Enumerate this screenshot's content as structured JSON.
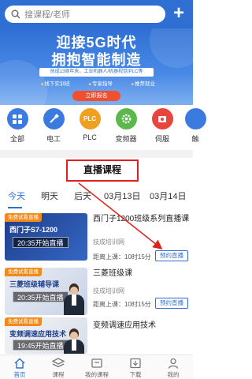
{
  "search": {
    "placeholder": "搜课程/老师"
  },
  "header": {
    "plus_icon": "plus-icon"
  },
  "banner": {
    "line1": "迎接5G时代",
    "line2": "拥抱智能制造",
    "subtitle": "技成13周年庆，工业机器人/机器视觉/PLC等",
    "tags": [
      "线下实训班",
      "专家指导",
      "推荐就业"
    ],
    "button": "立即报名"
  },
  "categories": [
    {
      "label": "全部",
      "icon": "grid-icon",
      "color": "#3b7be0"
    },
    {
      "label": "电工",
      "icon": "screwdriver-icon",
      "color": "#3b7be0"
    },
    {
      "label": "PLC",
      "icon": "plc-icon",
      "color": "#f0a020"
    },
    {
      "label": "变频器",
      "icon": "gear-icon",
      "color": "#5cb84a"
    },
    {
      "label": "伺服",
      "icon": "servo-icon",
      "color": "#e8453c"
    },
    {
      "label": "触",
      "icon": "touchscreen-icon",
      "color": "#3b7be0"
    }
  ],
  "live": {
    "title": "直播课程",
    "tabs": [
      "今天",
      "明天",
      "后天",
      "03月13日",
      "03月14日"
    ]
  },
  "courses": [
    {
      "badge": "免费试看直播",
      "thumb_title": "西门子S7-1200",
      "time": "20:35开始直播",
      "title": "西门子1200班级系列直播课",
      "org": "技成培训网",
      "dist": "距离上课：10时15分",
      "button": "预约直播"
    },
    {
      "badge": "免费试看直播",
      "thumb_title": "三菱班级辅导课",
      "time": "20:35开始直播",
      "title": "三菱班级课",
      "org": "技成培训网",
      "dist": "距离上课：10时15分",
      "button": "预约直播"
    },
    {
      "badge": "免费试看直播",
      "thumb_title": "变频调速应用技术",
      "time": "19:45开始直播",
      "title": "变频调速应用技术",
      "org": "",
      "dist": "",
      "button": ""
    }
  ],
  "bottom_nav": [
    {
      "label": "首页",
      "icon": "home-icon",
      "active": true
    },
    {
      "label": "课程",
      "icon": "layers-icon",
      "active": false
    },
    {
      "label": "我的课程",
      "icon": "my-course-icon",
      "active": false
    },
    {
      "label": "下载",
      "icon": "download-icon",
      "active": false
    },
    {
      "label": "我的",
      "icon": "user-icon",
      "active": false
    }
  ],
  "colors": {
    "primary": "#2f6fd4",
    "accent_red": "#e0201a",
    "badge_orange": "#f08a1c"
  }
}
